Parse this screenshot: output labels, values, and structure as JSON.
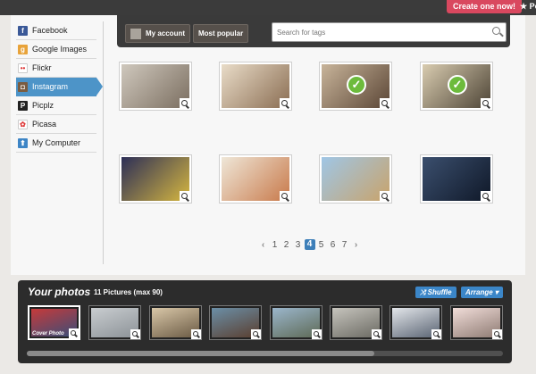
{
  "topbar": {
    "create_label": "Create one now!",
    "right_label": "★ Po"
  },
  "sidebar": {
    "items": [
      {
        "label": "Facebook",
        "icon": "facebook-icon",
        "glyph": "f",
        "color": "#3b5998"
      },
      {
        "label": "Google Images",
        "icon": "google-images-icon",
        "glyph": "g",
        "color": "#e8a33a"
      },
      {
        "label": "Flickr",
        "icon": "flickr-icon",
        "glyph": "••",
        "color": "#ffffff"
      },
      {
        "label": "Instagram",
        "icon": "instagram-icon",
        "glyph": "◘",
        "color": "#7a5c40",
        "active": true
      },
      {
        "label": "Picplz",
        "icon": "picplz-icon",
        "glyph": "P",
        "color": "#222222"
      },
      {
        "label": "Picasa",
        "icon": "picasa-icon",
        "glyph": "✿",
        "color": "#ffffff"
      },
      {
        "label": "My Computer",
        "icon": "computer-icon",
        "glyph": "⬆",
        "color": "#3d85c6"
      }
    ]
  },
  "toolbar": {
    "my_account_label": "My account",
    "most_popular_label": "Most popular",
    "search_placeholder": "Search for tags",
    "search_value": ""
  },
  "grid": {
    "photos": [
      {
        "icon": "cafe-interior-photo",
        "colors": [
          "#cfc8bd",
          "#7b6e60"
        ],
        "selected": false
      },
      {
        "icon": "pastries-photo",
        "colors": [
          "#e9dcc8",
          "#8a6d52"
        ],
        "selected": false
      },
      {
        "icon": "street-photo",
        "colors": [
          "#c8b49a",
          "#5b4636"
        ],
        "selected": true
      },
      {
        "icon": "station-photo",
        "colors": [
          "#d9ccb0",
          "#4d4436"
        ],
        "selected": true
      },
      {
        "icon": "pokemon-sign-photo",
        "colors": [
          "#2c2e57",
          "#d6b740"
        ],
        "selected": false
      },
      {
        "icon": "pasta-dish-photo",
        "colors": [
          "#efe7d8",
          "#c8794a"
        ],
        "selected": false
      },
      {
        "icon": "power-lines-photo",
        "colors": [
          "#9fc6e6",
          "#c9a36a"
        ],
        "selected": false
      },
      {
        "icon": "train-window-photo",
        "colors": [
          "#3b4f6e",
          "#0f1828"
        ],
        "selected": false
      }
    ]
  },
  "pagination": {
    "prev": "‹",
    "next": "›",
    "pages": [
      "1",
      "2",
      "3",
      "4",
      "5",
      "6",
      "7"
    ],
    "current": "4"
  },
  "tray": {
    "title": "Your photos",
    "count_text": "11 Pictures (max 90)",
    "shuffle_label": "⤨ Shuffle",
    "arrange_label": "Arrange ▾",
    "cover_label": "Cover Photo",
    "scroll_position": 0.73,
    "photos": [
      {
        "icon": "red-tent-photo",
        "colors": [
          "#c63a3a",
          "#3a4e79"
        ],
        "cover": true
      },
      {
        "icon": "foggy-lake-photo",
        "colors": [
          "#c9cdd0",
          "#8c9297"
        ]
      },
      {
        "icon": "plaza-photo",
        "colors": [
          "#d9c7a8",
          "#6a5a44"
        ]
      },
      {
        "icon": "market-photo",
        "colors": [
          "#6b8fa7",
          "#5a3e2f"
        ]
      },
      {
        "icon": "coast-photo",
        "colors": [
          "#9bb6cc",
          "#5e6a56"
        ]
      },
      {
        "icon": "alley-photo",
        "colors": [
          "#c6c4bd",
          "#6b6a63"
        ]
      },
      {
        "icon": "street-corner-photo",
        "colors": [
          "#e3e6ea",
          "#5a6473"
        ]
      },
      {
        "icon": "blossoms-photo",
        "colors": [
          "#f1ddd9",
          "#8e7b73"
        ]
      }
    ]
  }
}
